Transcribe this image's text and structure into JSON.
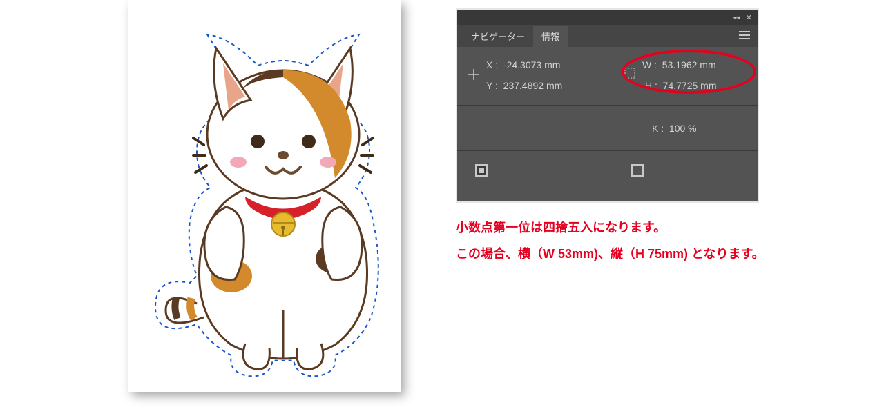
{
  "panel": {
    "tabs": {
      "navigator": "ナビゲーター",
      "info": "情報"
    },
    "x_label": "X :",
    "x_value": "-24.3073 mm",
    "y_label": "Y :",
    "y_value": "237.4892 mm",
    "w_label": "W :",
    "w_value": "53.1962 mm",
    "h_label": "H :",
    "h_value": "74.7725 mm",
    "k_label": "K :",
    "k_value": "100 %",
    "collapse_glyph": "◄◄",
    "close_glyph": "✕"
  },
  "caption": {
    "line1": "小数点第一位は四捨五入になります。",
    "line2": "この場合、横（W 53mm)、縦（H 75mm) となります。"
  }
}
